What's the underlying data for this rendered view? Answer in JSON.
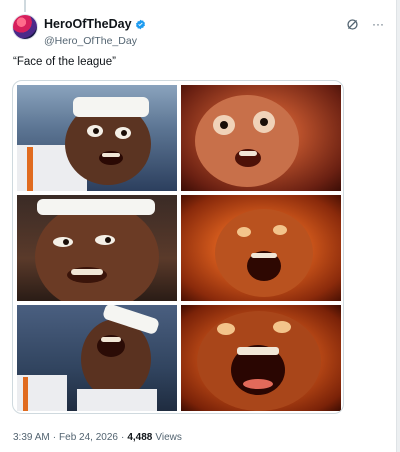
{
  "post": {
    "author": {
      "display_name": "HeroOfTheDay",
      "handle": "@Hero_OfThe_Day",
      "verified": true,
      "avatar_icon": "avatar-image"
    },
    "text": "“Face of the league”",
    "media": {
      "type": "image-grid",
      "panels": [
        "basketball-player-shocked-face",
        "horror-face-red",
        "basketball-player-grimace-face",
        "screaming-face-fire",
        "basketball-player-screaming-face",
        "screaming-face-fire-closeup"
      ]
    },
    "time": "3:39 AM",
    "separator": "·",
    "date": "Feb 24, 2026",
    "views_count": "4,488",
    "views_label": "Views"
  },
  "actions": {
    "grok_icon": "slash-circle-icon",
    "more_icon": "more-icon",
    "more_glyph": "···"
  },
  "colors": {
    "verified_badge": "#1d9bf0",
    "secondary_text": "#536471",
    "border": "#cfd9de"
  }
}
